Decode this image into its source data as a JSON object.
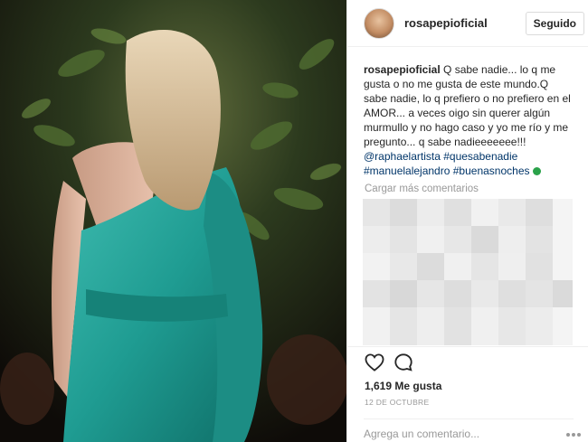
{
  "header": {
    "username": "rosapepioficial",
    "follow_label": "Seguido"
  },
  "caption": {
    "username": "rosapepioficial",
    "text": " Q sabe nadie... lo q me gusta o no me gusta de este mundo.Q sabe nadie, lo q prefiero o no prefiero en el AMOR... a veces oigo sin querer algún murmullo y no hago caso y yo me río y me pregunto... q sabe nadieeeeeee!!! ",
    "tags": [
      "@raphaelartista",
      "#quesabenadie",
      "#manuelalejandro",
      "#buenasnoches"
    ]
  },
  "comments": {
    "load_more_label": "Cargar más comentarios"
  },
  "actions": {
    "likes_label": "1,619 Me gusta",
    "date_label": "12 DE OCTUBRE"
  },
  "comment_input": {
    "placeholder": "Agrega un comentario..."
  },
  "icons": {
    "heart": "heart-icon",
    "comment": "comment-icon",
    "more": "more-options-icon",
    "globe": "globe-emoji-icon"
  },
  "colors": {
    "hashtag": "#003569",
    "muted": "#999999",
    "text": "#262626",
    "dress": "#2aa39a"
  }
}
